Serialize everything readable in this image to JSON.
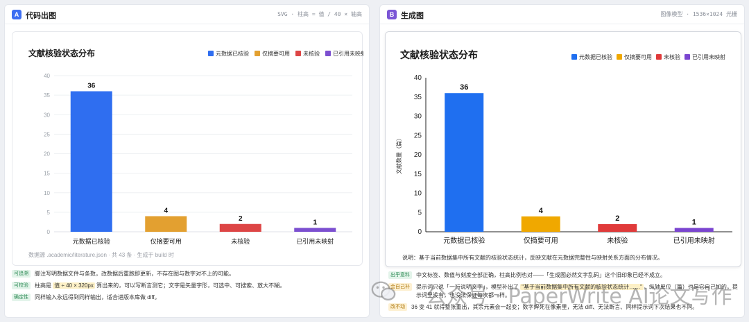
{
  "panel_a": {
    "badge": "A",
    "title": "代码出图",
    "meta": "SVG · 柱高 = 值 / 40 × 轴高",
    "footnote": "数据源 .academic/literature.json · 共 43 条 · 生成于 build 时",
    "notes": [
      {
        "tag": "可追溯",
        "text": "脚注写明数据文件与条数，改数据后重跑即更新，不存在图与数字对不上的可能。"
      },
      {
        "tag": "可校验",
        "pre": "柱高是 ",
        "hl": "值 ÷ 40 × 320px",
        "post": " 算出来的，可以写断言测它；文字是矢量字形，可选中、可搜索、放大不糊。"
      },
      {
        "tag": "确定性",
        "text": "同样输入永远得到同样输出，适合进版本库做 diff。"
      }
    ]
  },
  "panel_b": {
    "badge": "B",
    "title": "生成图",
    "meta": "图像模型 · 1536×1024 光栅",
    "caption": "说明：基于当前数据集中所有文献的核验状态统计，反映文献在元数据完整性与映射关系方面的分布情况。",
    "notes": [
      {
        "tag": "出乎意料",
        "style": "ok",
        "text": "中文标签、数值与刻度全部正确，柱高比例也对——「生成图必然文字乱码」这个旧印象已经不成立。"
      },
      {
        "tag": "会自己补",
        "style": "warn",
        "pre": "提示词只说「一行说明文字」，模型补出了 ",
        "hl": "\"基于当前数据集中所有文献的核验状态统计……\"",
        "post": "，纵轴单位（篇）也是它自己加的，提示词里没有，也没法保证每次都一样。"
      },
      {
        "tag": "改不动",
        "style": "warn",
        "text": "36 变 41 就得整张重出，其余元素会一起变；数字焊死在像素里，无法 diff、无法断言、同样提示词下次结果也不同。"
      }
    ]
  },
  "watermark": "公众号 · PaperWrite AI论文写作",
  "colors": {
    "blue": "#2f6ef0",
    "orange": "#e3a030",
    "red": "#dd4545",
    "purple": "#7c4fd0"
  },
  "chart_data": [
    {
      "type": "bar",
      "title": "文献核验状态分布",
      "categories": [
        "元数据已核验",
        "仅摘要可用",
        "未核验",
        "已引用未映射"
      ],
      "values": [
        36,
        4,
        2,
        1
      ],
      "ylim": [
        0,
        40
      ],
      "yticks": [
        0,
        5,
        10,
        15,
        20,
        25,
        30,
        35,
        40
      ],
      "xlabel": "",
      "ylabel": "",
      "grid": true,
      "legend": "top-right",
      "series": [
        {
          "name": "元数据已核验",
          "color": "#2f6ef0"
        },
        {
          "name": "仅摘要可用",
          "color": "#e3a030"
        },
        {
          "name": "未核验",
          "color": "#dd4545"
        },
        {
          "name": "已引用未映射",
          "color": "#7c4fd0"
        }
      ]
    },
    {
      "type": "bar",
      "title": "文献核验状态分布",
      "categories": [
        "元数据已核验",
        "仅摘要可用",
        "未核验",
        "已引用未映射"
      ],
      "values": [
        36,
        4,
        2,
        1
      ],
      "ylim": [
        0,
        40
      ],
      "yticks": [
        0,
        5,
        10,
        15,
        20,
        25,
        30,
        35,
        40
      ],
      "xlabel": "",
      "ylabel": "文献数量（篇）",
      "grid": false,
      "legend": "top-right",
      "series": [
        {
          "name": "元数据已核验",
          "color": "#1f6ff0"
        },
        {
          "name": "仅摘要可用",
          "color": "#f0a800"
        },
        {
          "name": "未核验",
          "color": "#e03a3a"
        },
        {
          "name": "已引用未映射",
          "color": "#7a45d0"
        }
      ]
    }
  ]
}
